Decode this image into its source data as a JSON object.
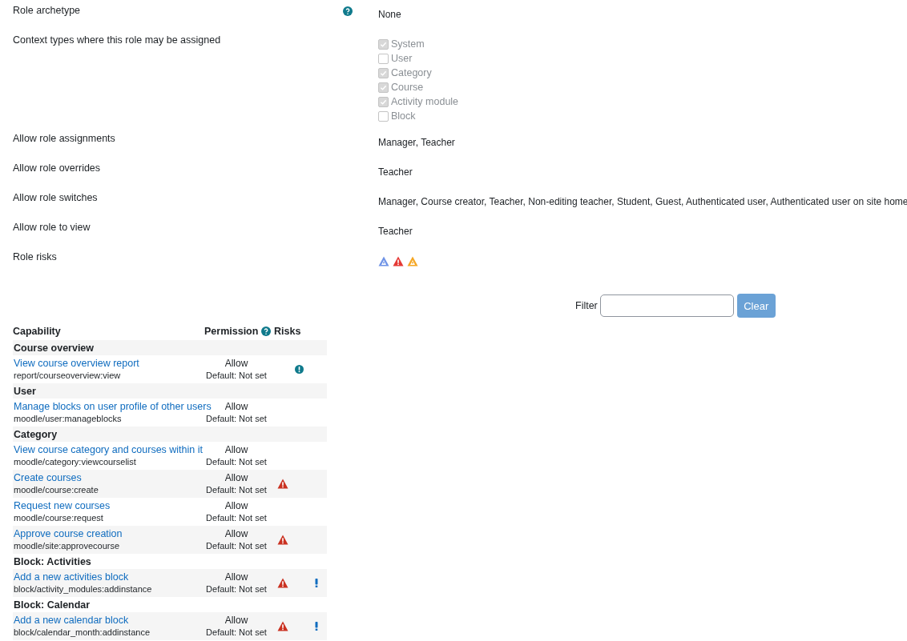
{
  "form": {
    "rows": [
      {
        "kind": "text",
        "label": "Role archetype",
        "help": true,
        "value": "None"
      },
      {
        "kind": "checklist",
        "label": "Context types where this role may be assigned",
        "help": false,
        "options": [
          {
            "label": "System",
            "checked": true,
            "disabled": true
          },
          {
            "label": "User",
            "checked": false,
            "disabled": true
          },
          {
            "label": "Category",
            "checked": true,
            "disabled": true
          },
          {
            "label": "Course",
            "checked": true,
            "disabled": true
          },
          {
            "label": "Activity module",
            "checked": true,
            "disabled": true
          },
          {
            "label": "Block",
            "checked": false,
            "disabled": true
          }
        ]
      },
      {
        "kind": "text",
        "label": "Allow role assignments",
        "help": false,
        "value": "Manager, Teacher"
      },
      {
        "kind": "text",
        "label": "Allow role overrides",
        "help": false,
        "value": "Teacher"
      },
      {
        "kind": "text",
        "label": "Allow role switches",
        "help": false,
        "value": "Manager, Course creator, Teacher, Non-editing teacher, Student, Guest, Authenticated user, Authenticated user on site home"
      },
      {
        "kind": "text",
        "label": "Allow role to view",
        "help": false,
        "value": "Teacher"
      },
      {
        "kind": "risks",
        "label": "Role risks",
        "help": false,
        "risks": [
          {
            "kind": "blue"
          },
          {
            "kind": "red"
          },
          {
            "kind": "orange"
          }
        ]
      }
    ]
  },
  "filter": {
    "label": "Filter",
    "button": "Clear"
  },
  "table": {
    "columns": [
      {
        "label": "Capability",
        "help": false
      },
      {
        "label": "Permission",
        "help": true
      },
      {
        "label": "Risks",
        "help": false
      }
    ],
    "rows": [
      {
        "kind": "group",
        "title": "Course overview"
      },
      {
        "kind": "capability",
        "name": "View course overview report",
        "code": "report/courseoverview:view",
        "permission": "Allow",
        "default": "Default: Not set",
        "risks": [
          {
            "kind": "info"
          }
        ]
      },
      {
        "kind": "group",
        "title": "User"
      },
      {
        "kind": "capability",
        "name": "Manage blocks on user profile of other users",
        "code": "moodle/user:manageblocks",
        "permission": "Allow",
        "default": "Default: Not set",
        "risks": []
      },
      {
        "kind": "group",
        "title": "Category"
      },
      {
        "kind": "capability",
        "name": "View course category and courses within it",
        "code": "moodle/category:viewcourselist",
        "permission": "Allow",
        "default": "Default: Not set",
        "risks": []
      },
      {
        "kind": "capability",
        "name": "Create courses",
        "code": "moodle/course:create",
        "permission": "Allow",
        "default": "Default: Not set",
        "risks": [
          {
            "kind": "warning"
          }
        ]
      },
      {
        "kind": "capability",
        "name": "Request new courses",
        "code": "moodle/course:request",
        "permission": "Allow",
        "default": "Default: Not set",
        "risks": []
      },
      {
        "kind": "capability",
        "name": "Approve course creation",
        "code": "moodle/site:approvecourse",
        "permission": "Allow",
        "default": "Default: Not set",
        "risks": [
          {
            "kind": "warning"
          }
        ]
      },
      {
        "kind": "group",
        "title": "Block: Activities"
      },
      {
        "kind": "capability",
        "name": "Add a new activities block",
        "code": "block/activity_modules:addinstance",
        "permission": "Allow",
        "default": "Default: Not set",
        "risks": [
          {
            "kind": "warning"
          },
          {
            "kind": "alert"
          }
        ]
      },
      {
        "kind": "group",
        "title": "Block: Calendar"
      },
      {
        "kind": "capability",
        "name": "Add a new calendar block",
        "code": "block/calendar_month:addinstance",
        "permission": "Allow",
        "default": "Default: Not set",
        "risks": [
          {
            "kind": "warning"
          },
          {
            "kind": "alert"
          }
        ]
      }
    ]
  }
}
